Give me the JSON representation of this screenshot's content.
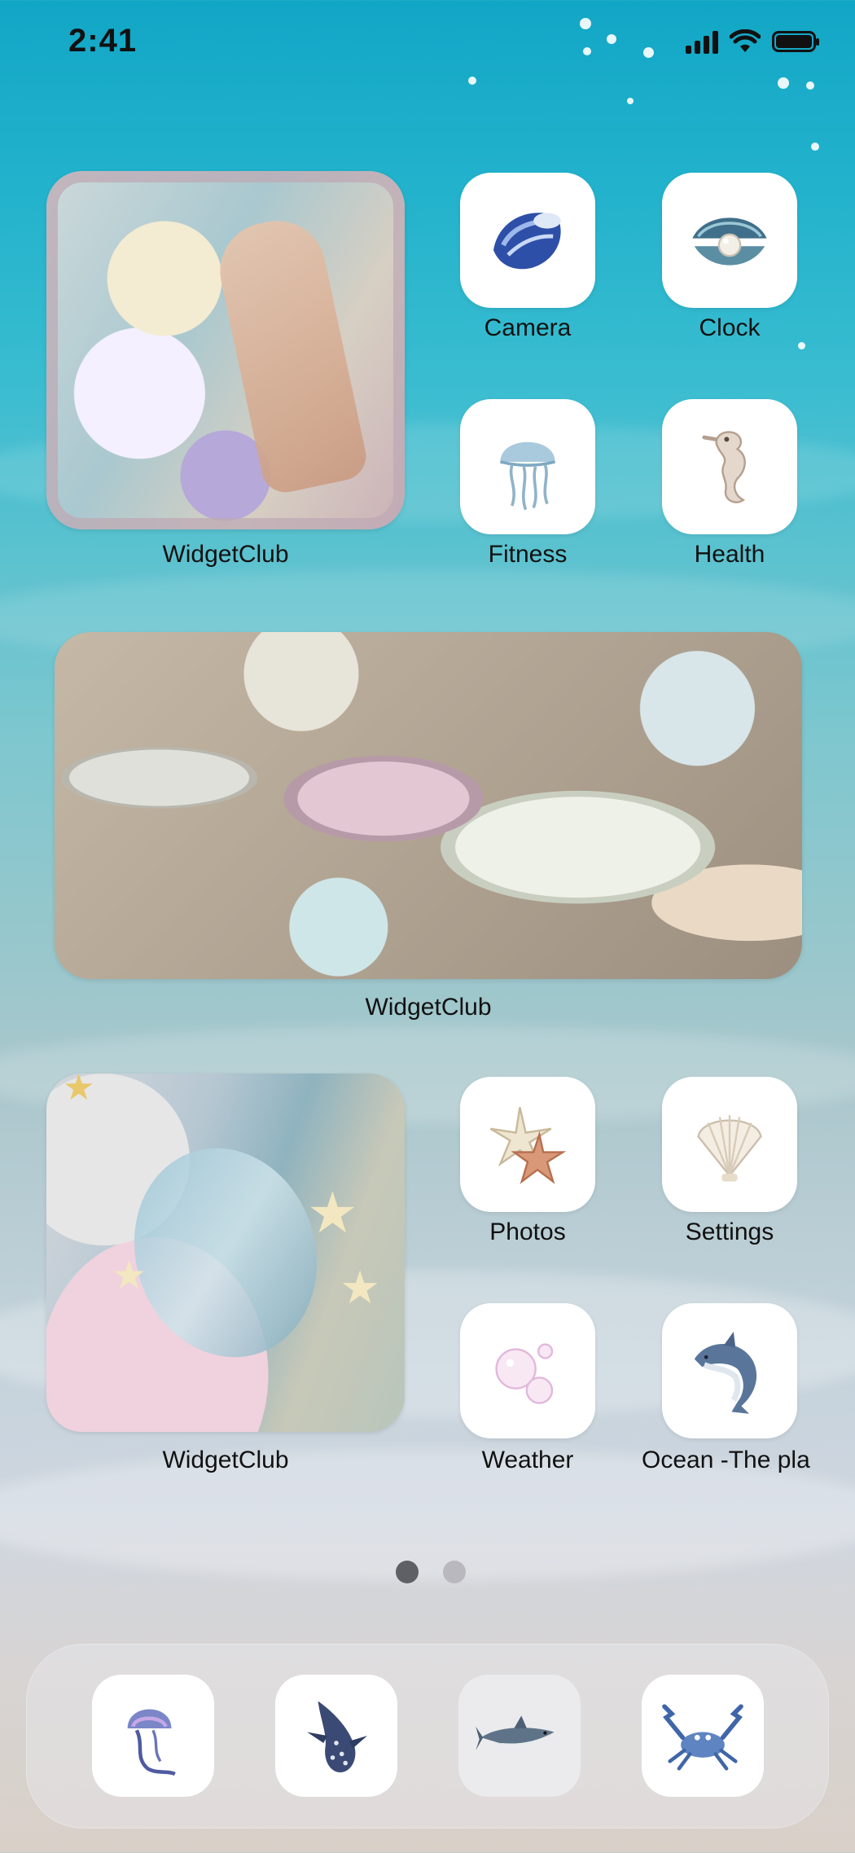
{
  "status_bar": {
    "time": "2:41"
  },
  "widgets": [
    {
      "label": "WidgetClub"
    },
    {
      "label": "WidgetClub"
    },
    {
      "label": "WidgetClub"
    }
  ],
  "apps": {
    "camera": {
      "label": "Camera",
      "icon": "shell-icon"
    },
    "clock": {
      "label": "Clock",
      "icon": "pearl-oyster-icon"
    },
    "fitness": {
      "label": "Fitness",
      "icon": "jellyfish-icon"
    },
    "health": {
      "label": "Health",
      "icon": "seahorse-icon"
    },
    "photos": {
      "label": "Photos",
      "icon": "starfish-icon"
    },
    "settings": {
      "label": "Settings",
      "icon": "scallop-shell-icon"
    },
    "weather": {
      "label": "Weather",
      "icon": "bubbles-icon"
    },
    "ocean": {
      "label": "Ocean -The pla",
      "icon": "dolphin-icon"
    }
  },
  "page_indicator": {
    "pages": 2,
    "current": 1
  },
  "dock": [
    {
      "icon": "jellyfish-icon"
    },
    {
      "icon": "whale-shark-icon"
    },
    {
      "icon": "shark-icon"
    },
    {
      "icon": "crab-icon"
    }
  ],
  "colors": {
    "label_text": "#111111",
    "icon_background": "#ffffff",
    "dot_active": "#5f5f66",
    "dot_inactive": "#b8b8be"
  }
}
